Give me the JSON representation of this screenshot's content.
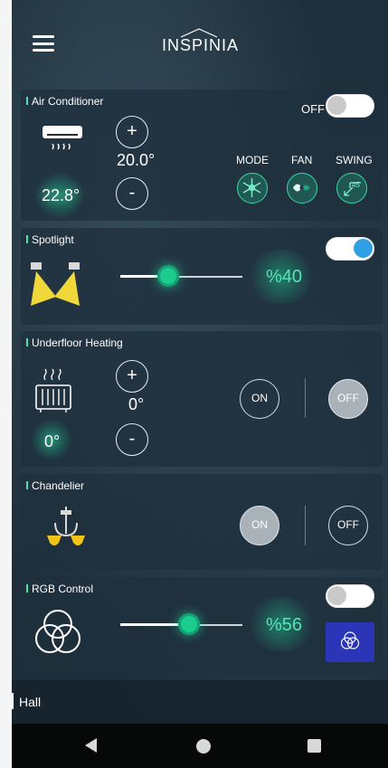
{
  "header": {
    "logo_text": "INSPINIA"
  },
  "air_conditioner": {
    "title": "Air Conditioner",
    "power_label": "OFF",
    "power_on": false,
    "plus_label": "+",
    "minus_label": "-",
    "set_temp": "20.0°",
    "room_temp": "22.8°",
    "controls": [
      {
        "label": "MODE",
        "icon": "snowflake-icon"
      },
      {
        "label": "FAN",
        "icon": "fan-icon"
      },
      {
        "label": "SWING",
        "icon": "swing-45-icon"
      }
    ],
    "swing_value": "45"
  },
  "spotlight": {
    "title": "Spotlight",
    "power_on": true,
    "level_percent": 40,
    "level_text": "%40"
  },
  "underfloor_heating": {
    "title": "Underfloor Heating",
    "plus_label": "+",
    "minus_label": "-",
    "set_temp": "0°",
    "room_temp": "0°",
    "on_label": "ON",
    "off_label": "OFF",
    "active": "off"
  },
  "chandelier": {
    "title": "Chandelier",
    "on_label": "ON",
    "off_label": "OFF",
    "active": "on"
  },
  "rgb_control": {
    "title": "RGB Control",
    "power_on": false,
    "level_percent": 56,
    "level_text": "%56",
    "swatch_color": "#2a35b8"
  },
  "footer": {
    "room_label": "Hall"
  },
  "colors": {
    "accent": "#4fe0b0",
    "toggle_on": "#2f9fe6",
    "swatch": "#2a35b8"
  }
}
